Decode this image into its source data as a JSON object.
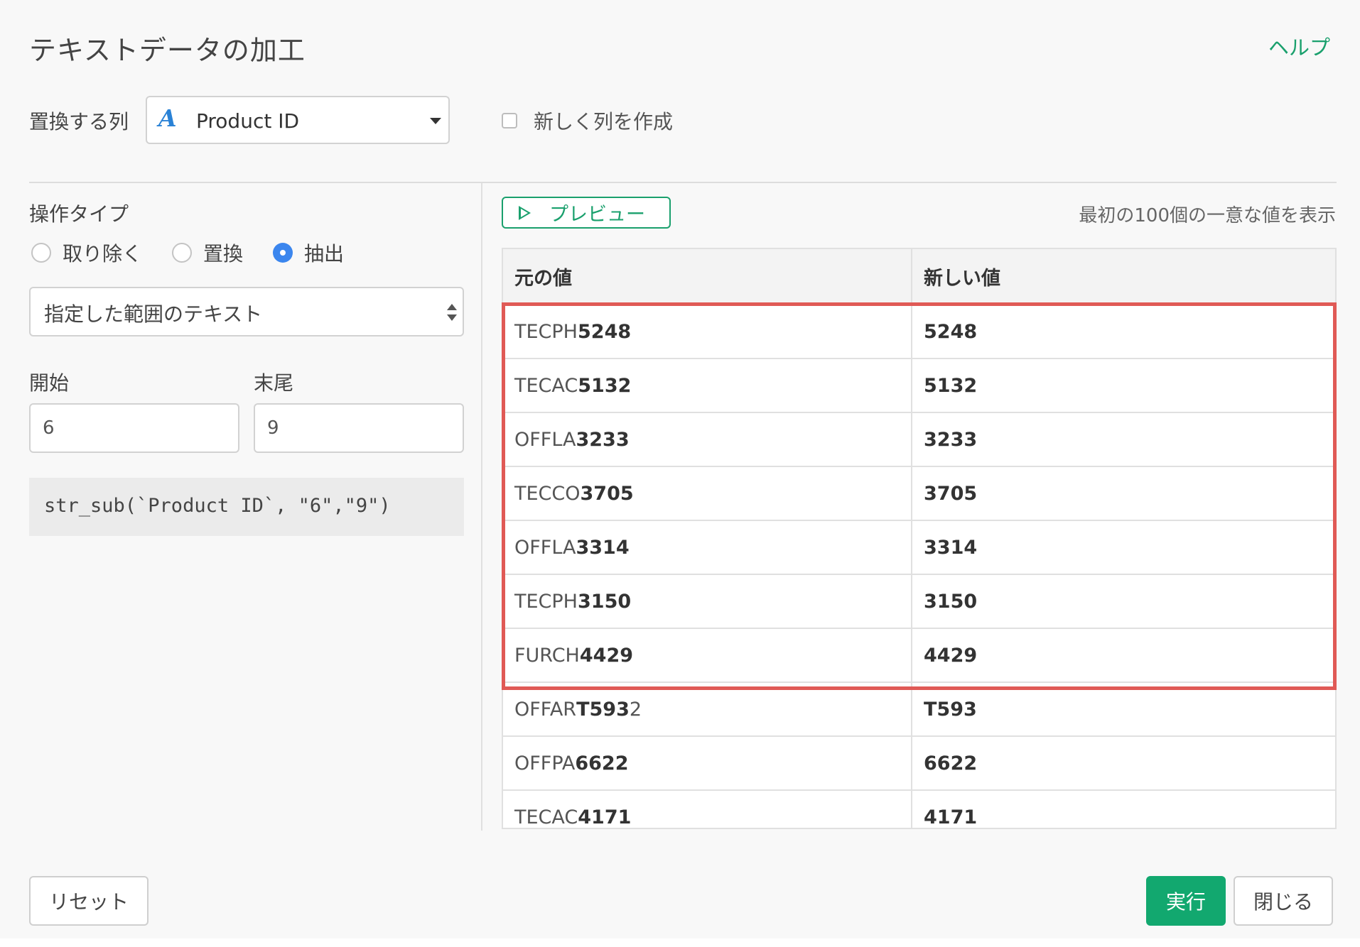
{
  "dialog": {
    "title": "テキストデータの加工",
    "help_label": "ヘルプ"
  },
  "column": {
    "label": "置換する列",
    "type_icon": "A",
    "selected": "Product ID",
    "new_column_label": "新しく列を作成",
    "new_column_checked": false
  },
  "operation": {
    "label": "操作タイプ",
    "options": [
      "取り除く",
      "置換",
      "抽出"
    ],
    "selected": "抽出",
    "range_select": "指定した範囲のテキスト",
    "start_label": "開始",
    "end_label": "末尾",
    "start_value": "6",
    "end_value": "9",
    "code": "str_sub(`Product ID`, \"6\",\"9\")"
  },
  "preview": {
    "button_label": "プレビュー",
    "note": "最初の100個の一意な値を表示",
    "headers": [
      "元の値",
      "新しい値"
    ],
    "rows": [
      {
        "orig_prefix": "TECPH",
        "orig_match": "5248",
        "orig_suffix": "",
        "new": "5248"
      },
      {
        "orig_prefix": "TECAC",
        "orig_match": "5132",
        "orig_suffix": "",
        "new": "5132"
      },
      {
        "orig_prefix": "OFFLA",
        "orig_match": "3233",
        "orig_suffix": "",
        "new": "3233"
      },
      {
        "orig_prefix": "TECCO",
        "orig_match": "3705",
        "orig_suffix": "",
        "new": "3705"
      },
      {
        "orig_prefix": "OFFLA",
        "orig_match": "3314",
        "orig_suffix": "",
        "new": "3314"
      },
      {
        "orig_prefix": "TECPH",
        "orig_match": "3150",
        "orig_suffix": "",
        "new": "3150"
      },
      {
        "orig_prefix": "FURCH",
        "orig_match": "4429",
        "orig_suffix": "",
        "new": "4429"
      },
      {
        "orig_prefix": "OFFAR",
        "orig_match": "T593",
        "orig_suffix": "2",
        "new": "T593"
      },
      {
        "orig_prefix": "OFFPA",
        "orig_match": "6622",
        "orig_suffix": "",
        "new": "6622"
      },
      {
        "orig_prefix": "TECAC",
        "orig_match": "4171",
        "orig_suffix": "",
        "new": "4171"
      }
    ]
  },
  "footer": {
    "reset_label": "リセット",
    "run_label": "実行",
    "close_label": "閉じる"
  },
  "colors": {
    "accent_green": "#1aa06d",
    "run_green": "#12a86f",
    "radio_blue": "#3b86ee",
    "highlight_red": "#e05a56",
    "type_icon_blue": "#2a82d6"
  }
}
